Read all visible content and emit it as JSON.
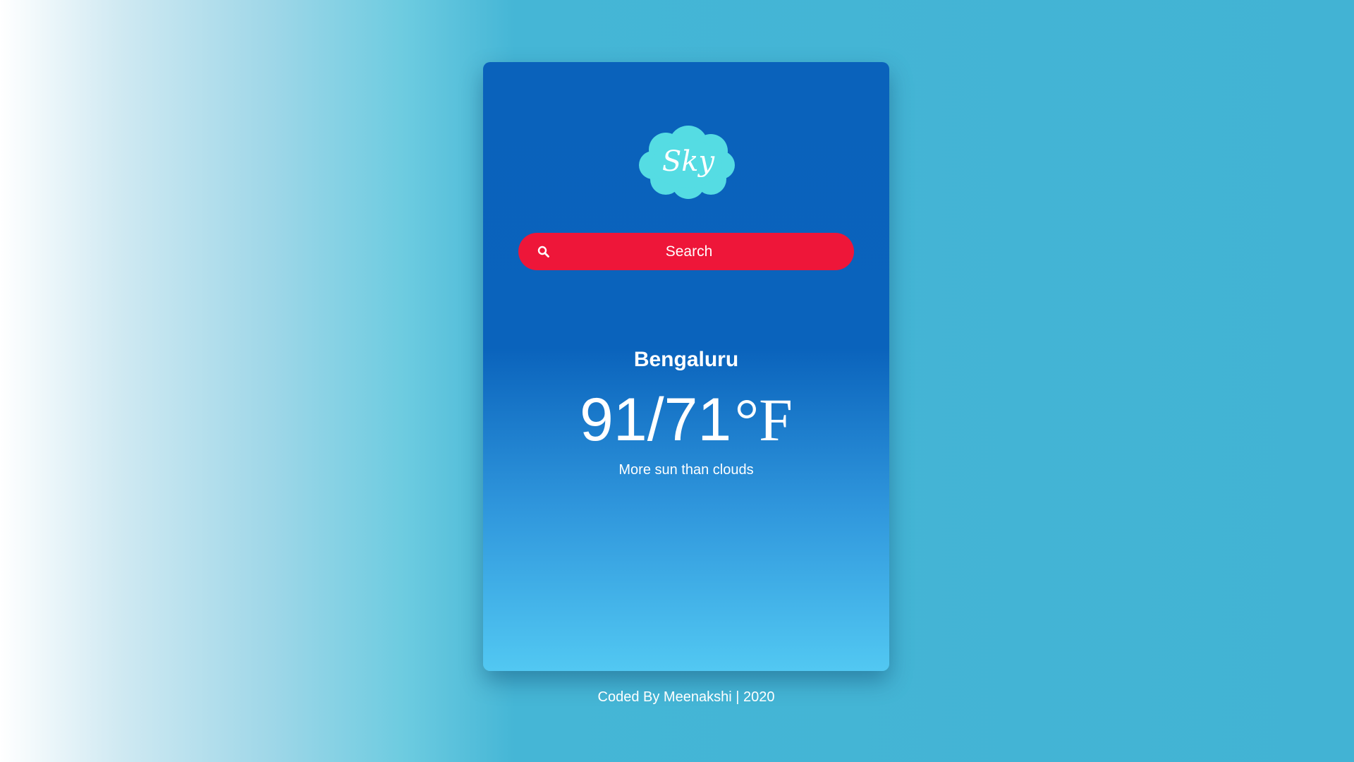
{
  "logo": {
    "text": "Sky",
    "icon": "cloud-icon",
    "color": "#55dce3"
  },
  "search": {
    "placeholder": "Search",
    "value": "",
    "icon": "search-icon",
    "color": "#ee1639"
  },
  "weather": {
    "city": "Bengaluru",
    "temperature": "91/71",
    "unit": "°F",
    "condition": "More sun than clouds"
  },
  "footer": {
    "text": "Coded By Meenakshi | 2020"
  },
  "colors": {
    "card_top": "#0a62bb",
    "card_bottom": "#52c8f2",
    "background": "#42b3d4",
    "text": "#ffffff"
  }
}
